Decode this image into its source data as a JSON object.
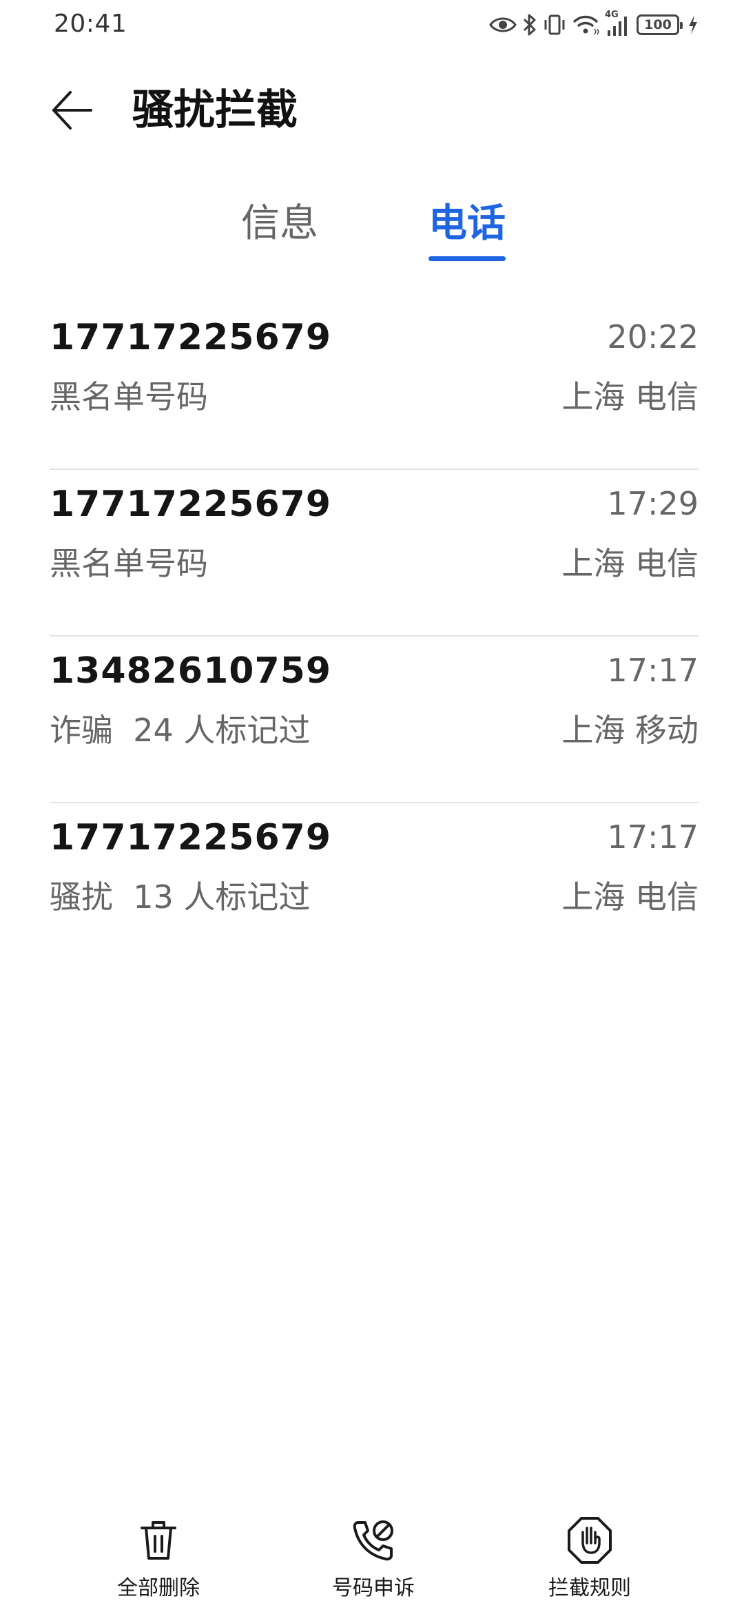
{
  "status_bar": {
    "time": "20:41",
    "network": "4G",
    "battery": "100",
    "icons": [
      "eye-comfort-icon",
      "bluetooth-icon",
      "vibrate-icon",
      "wifi-icon",
      "signal-icon",
      "battery-icon",
      "charging-icon"
    ]
  },
  "header": {
    "title": "骚扰拦截",
    "back_icon": "arrow-left-icon"
  },
  "tabs": [
    {
      "label": "信息",
      "active": false
    },
    {
      "label": "电话",
      "active": true
    }
  ],
  "colors": {
    "accent": "#1f64e0",
    "primary_text": "#151515",
    "secondary_text": "#666666",
    "divider": "#e4e4e4"
  },
  "calls": [
    {
      "number": "17717225679",
      "time": "20:22",
      "label": "黑名单号码",
      "location": "上海 电信"
    },
    {
      "number": "17717225679",
      "time": "17:29",
      "label": "黑名单号码",
      "location": "上海 电信"
    },
    {
      "number": "13482610759",
      "time": "17:17",
      "label": "诈骗  24 人标记过",
      "location": "上海 移动"
    },
    {
      "number": "17717225679",
      "time": "17:17",
      "label": "骚扰  13 人标记过",
      "location": "上海 电信"
    }
  ],
  "toolbar": {
    "delete_all": {
      "label": "全部删除",
      "icon": "trash-icon"
    },
    "appeal": {
      "label": "号码申诉",
      "icon": "phone-appeal-icon"
    },
    "rules": {
      "label": "拦截规则",
      "icon": "hand-stop-icon"
    }
  }
}
